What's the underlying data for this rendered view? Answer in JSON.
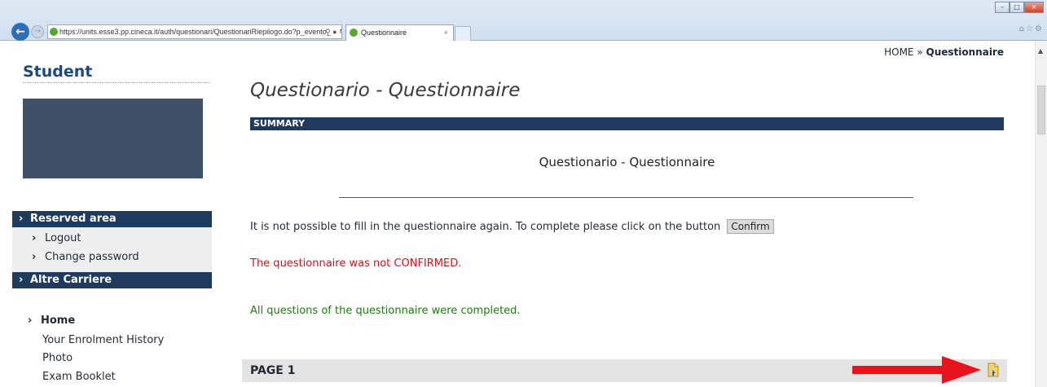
{
  "browser": {
    "url": "https://units.esse3.pp.cineca.it/auth/questionari/QuestionariRiepilogo.do?p_evento_",
    "tab_title": "Questionnaire",
    "icons": [
      "back-icon",
      "forward-icon",
      "search-icon",
      "lock-icon",
      "refresh-icon",
      "close-icon",
      "home-icon",
      "star-icon",
      "gear-icon"
    ]
  },
  "sidebar": {
    "title": "Student",
    "reserved_area": "Reserved area",
    "reserved_items": [
      "Logout",
      "Change password"
    ],
    "altre_carriere": "Altre Carriere",
    "nav": {
      "home": "Home",
      "links": [
        "Your Enrolment History",
        "Photo",
        "Exam Booklet"
      ]
    }
  },
  "breadcrumb": {
    "home": "HOME",
    "separator": "»",
    "current": "Questionnaire"
  },
  "main": {
    "title": "Questionario - Questionnaire",
    "summary_label": "SUMMARY",
    "center_title": "Questionario - Questionnaire",
    "info_text": "It is not possible to fill in the questionnaire again. To complete please click on the button",
    "confirm_label": "Confirm",
    "not_confirmed_prefix": "The questionnaire was not ",
    "not_confirmed_strong": "CONFIRMED",
    "not_confirmed_suffix": ".",
    "completed_text": "All questions of the questionnaire were completed.",
    "page_label": "PAGE 1"
  },
  "colors": {
    "header_dark": "#1e3a5c",
    "title_blue": "#1c4a7e",
    "error_red": "#d0141c",
    "success_green": "#1d7a10",
    "annotation_arrow": "#e8141b"
  }
}
